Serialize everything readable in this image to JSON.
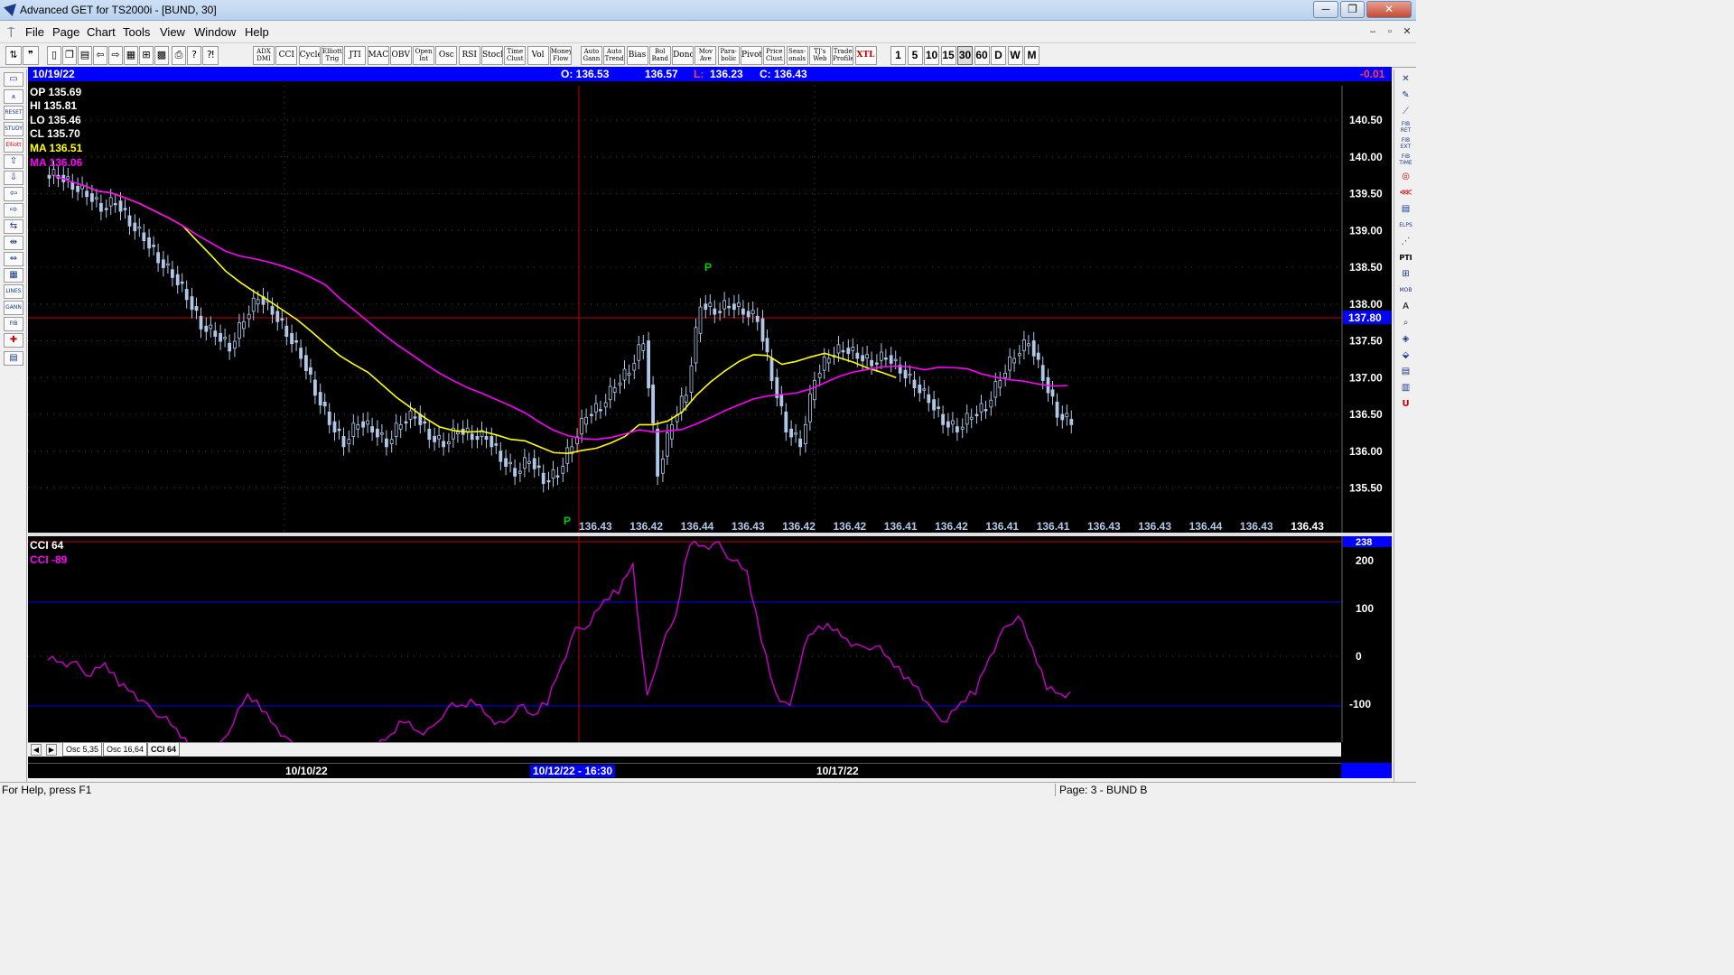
{
  "window": {
    "title": "Advanced GET for TS2000i - [BUND, 30]",
    "controls": [
      "─",
      "❐",
      "✕"
    ]
  },
  "menu": [
    "File",
    "Page",
    "Chart",
    "Tools",
    "View",
    "Window",
    "Help"
  ],
  "toolbar": {
    "indicators": [
      "ADX\nDMI",
      "CCI",
      "Cycles",
      "Elliott\nTrig",
      "JTI",
      "MACD",
      "OBV",
      "Open\nInt",
      "Osc",
      "RSI",
      "Stoch",
      "Time\nClust",
      "Vol",
      "Money\nFlow",
      "Auto\nGann",
      "Auto\nTrend",
      "Bias",
      "Bol\nBand",
      "Donch",
      "Mov\nAve",
      "Para-\nbolic",
      "Pivot",
      "Price\nClust",
      "Seas-\nonals",
      "TJ's\nWeb",
      "Trade\nProfile",
      "XTL"
    ],
    "intervals": [
      "1",
      "5",
      "10",
      "15",
      "30",
      "60",
      "D",
      "W",
      "M"
    ],
    "active_interval": "30"
  },
  "infobar": {
    "date": "10/19/22",
    "open": "O: 136.53",
    "high": "136.57",
    "low_label": "L:",
    "low": "136.23",
    "close": "C: 136.43",
    "change": "-0.01"
  },
  "legend": {
    "op": "OP  135.69",
    "hi": "HI   135.81",
    "lo": "LO  135.46",
    "cl": "CL  135.70",
    "ma_yellow": "MA  136.51",
    "ma_magenta": "MA  136.06"
  },
  "price_axis": [
    "140.50",
    "140.00",
    "139.50",
    "139.00",
    "138.50",
    "138.00",
    "137.50",
    "137.00",
    "136.50",
    "136.00",
    "135.50"
  ],
  "price_marker": "137.80",
  "pivot_label": "P",
  "bottom_values": [
    "136.43",
    "136.42",
    "136.44",
    "136.43",
    "136.42",
    "136.42",
    "136.41",
    "136.42",
    "136.41",
    "136.41",
    "136.43",
    "136.43",
    "136.44",
    "136.43",
    "136.43"
  ],
  "cci": {
    "title": "CCI 64",
    "value_label": "CCI  -89",
    "axis": [
      "200",
      "100",
      "0",
      "-100"
    ],
    "top_marker": "238"
  },
  "osc_tabs": [
    "Osc 5,35",
    "Osc 16,64",
    "CCI 64"
  ],
  "active_osc_tab": "CCI 64",
  "dates": {
    "d1": "10/10/22",
    "cursor": "10/12/22 - 16:30",
    "d3": "10/17/22"
  },
  "status": {
    "help": "For Help, press F1",
    "page": "Page: 3 - BUND B"
  },
  "colors": {
    "background": "#000000",
    "candle": "#b0c8e8",
    "ma_fast": "#ffff00",
    "ma_slow": "#ff00ff",
    "cci_line": "#cc00cc",
    "crosshair": "#ff0000",
    "band": "#0000ff",
    "pivot": "#00cc00"
  },
  "chart_data": {
    "type": "candlestick",
    "series": [
      {
        "name": "BUND 30",
        "values": [
          139.75,
          139.6,
          139.5,
          139.3,
          139.4,
          139.1,
          138.9,
          138.6,
          138.4,
          138.1,
          137.7,
          137.6,
          137.4,
          137.8,
          138.1,
          137.9,
          137.6,
          137.3,
          136.8,
          136.4,
          136.1,
          136.4,
          136.3,
          136.1,
          136.4,
          136.5,
          136.2,
          136.1,
          136.3,
          136.2,
          136.2,
          135.9,
          135.7,
          135.9,
          135.6,
          135.7,
          136.1,
          136.5,
          136.6,
          136.9,
          137.1,
          137.5,
          135.7,
          136.4,
          136.8,
          138.0,
          137.9,
          138.0,
          137.9,
          137.8,
          137.0,
          136.3,
          136.1,
          137.0,
          137.3,
          137.4,
          137.3,
          137.2,
          137.3,
          137.1,
          136.9,
          136.7,
          136.4,
          136.3,
          136.5,
          136.6,
          137.0,
          137.3,
          137.5,
          137.0,
          136.5,
          136.4
        ]
      }
    ]
  }
}
